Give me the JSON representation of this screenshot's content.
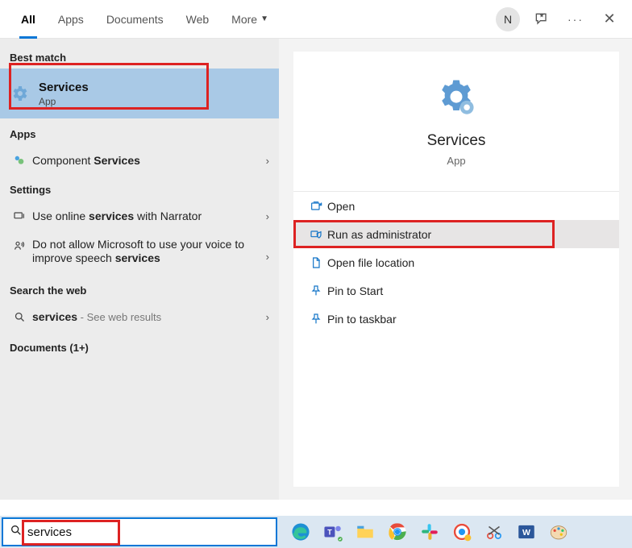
{
  "topbar": {
    "tabs": [
      "All",
      "Apps",
      "Documents",
      "Web",
      "More"
    ],
    "avatar_letter": "N"
  },
  "left": {
    "best_match_label": "Best match",
    "best_match": {
      "title": "Services",
      "subtitle": "App"
    },
    "apps_label": "Apps",
    "apps_item_prefix": "Component ",
    "apps_item_bold": "Services",
    "settings_label": "Settings",
    "setting1_pre": "Use online ",
    "setting1_bold": "services",
    "setting1_post": " with Narrator",
    "setting2_pre": "Do not allow Microsoft to use your voice to improve speech ",
    "setting2_bold": "services",
    "web_label": "Search the web",
    "web_item_bold": "services",
    "web_item_post": " - See web results",
    "documents_label": "Documents (1+)"
  },
  "right": {
    "title": "Services",
    "subtitle": "App",
    "actions": [
      "Open",
      "Run as administrator",
      "Open file location",
      "Pin to Start",
      "Pin to taskbar"
    ]
  },
  "search": {
    "value": "services"
  }
}
